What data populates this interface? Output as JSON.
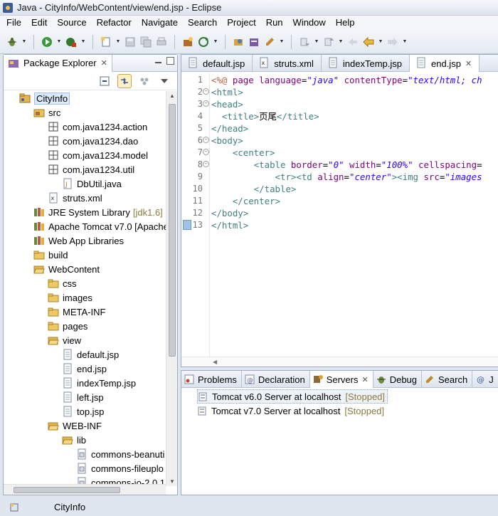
{
  "window": {
    "title": "Java - CityInfo/WebContent/view/end.jsp - Eclipse"
  },
  "menu": [
    "File",
    "Edit",
    "Source",
    "Refactor",
    "Navigate",
    "Search",
    "Project",
    "Run",
    "Window",
    "Help"
  ],
  "package_explorer": {
    "title": "Package Explorer",
    "tree": [
      {
        "label": "CityInfo",
        "indent": 0,
        "icon": "project-icon",
        "selected": true
      },
      {
        "label": "src",
        "indent": 1,
        "icon": "source-folder-icon"
      },
      {
        "label": "com.java1234.action",
        "indent": 2,
        "icon": "package-icon"
      },
      {
        "label": "com.java1234.dao",
        "indent": 2,
        "icon": "package-icon"
      },
      {
        "label": "com.java1234.model",
        "indent": 2,
        "icon": "package-icon"
      },
      {
        "label": "com.java1234.util",
        "indent": 2,
        "icon": "package-icon"
      },
      {
        "label": "DbUtil.java",
        "indent": 3,
        "icon": "java-file-icon"
      },
      {
        "label": "struts.xml",
        "indent": 2,
        "icon": "xml-file-icon"
      },
      {
        "label": "JRE System Library",
        "deco": "[jdk1.6]",
        "indent": 1,
        "icon": "library-icon"
      },
      {
        "label": "Apache Tomcat v7.0 [Apache",
        "indent": 1,
        "icon": "library-icon"
      },
      {
        "label": "Web App Libraries",
        "indent": 1,
        "icon": "library-icon"
      },
      {
        "label": "build",
        "indent": 1,
        "icon": "folder-icon"
      },
      {
        "label": "WebContent",
        "indent": 1,
        "icon": "folder-open-icon"
      },
      {
        "label": "css",
        "indent": 2,
        "icon": "folder-icon"
      },
      {
        "label": "images",
        "indent": 2,
        "icon": "folder-icon"
      },
      {
        "label": "META-INF",
        "indent": 2,
        "icon": "folder-icon"
      },
      {
        "label": "pages",
        "indent": 2,
        "icon": "folder-icon"
      },
      {
        "label": "view",
        "indent": 2,
        "icon": "folder-open-icon"
      },
      {
        "label": "default.jsp",
        "indent": 3,
        "icon": "jsp-file-icon"
      },
      {
        "label": "end.jsp",
        "indent": 3,
        "icon": "jsp-file-icon"
      },
      {
        "label": "indexTemp.jsp",
        "indent": 3,
        "icon": "jsp-file-icon"
      },
      {
        "label": "left.jsp",
        "indent": 3,
        "icon": "jsp-file-icon"
      },
      {
        "label": "top.jsp",
        "indent": 3,
        "icon": "jsp-file-icon"
      },
      {
        "label": "WEB-INF",
        "indent": 2,
        "icon": "folder-open-icon"
      },
      {
        "label": "lib",
        "indent": 3,
        "icon": "folder-open-icon"
      },
      {
        "label": "commons-beanuti",
        "indent": 4,
        "icon": "jar-file-icon"
      },
      {
        "label": "commons-fileuplo",
        "indent": 4,
        "icon": "jar-file-icon"
      },
      {
        "label": "commons-io-2.0.1",
        "indent": 4,
        "icon": "jar-file-icon"
      }
    ]
  },
  "editor": {
    "tabs": [
      {
        "label": "default.jsp",
        "active": false
      },
      {
        "label": "struts.xml",
        "active": false
      },
      {
        "label": "indexTemp.jsp",
        "active": false
      },
      {
        "label": "end.jsp",
        "active": true
      }
    ],
    "lines": [
      {
        "n": "1",
        "fold": false,
        "html": "<span class=\"jsp\">&lt;%@</span> <span class=\"attr\">page</span> <span class=\"attr\">language</span>=<span class=\"str\">\"java\"</span> <span class=\"attr\">contentType</span>=<span class=\"str\">\"text/html; ch</span>"
      },
      {
        "n": "2",
        "fold": true,
        "html": "<span class=\"tag\">&lt;html&gt;</span>"
      },
      {
        "n": "3",
        "fold": true,
        "html": "<span class=\"tag\">&lt;head&gt;</span>"
      },
      {
        "n": "4",
        "fold": false,
        "html": "  <span class=\"tag\">&lt;title&gt;</span>页尾<span class=\"tag\">&lt;/title&gt;</span>"
      },
      {
        "n": "5",
        "fold": false,
        "html": "<span class=\"tag\">&lt;/head&gt;</span>"
      },
      {
        "n": "6",
        "fold": true,
        "html": "<span class=\"tag\">&lt;body&gt;</span>"
      },
      {
        "n": "7",
        "fold": true,
        "html": "    <span class=\"tag\">&lt;center&gt;</span>"
      },
      {
        "n": "8",
        "fold": true,
        "html": "        <span class=\"tag\">&lt;table</span> <span class=\"attr\">border</span>=<span class=\"str\">\"0\"</span> <span class=\"attr\">width</span>=<span class=\"str\">\"100%\"</span> <span class=\"attr\">cellspacing</span>="
      },
      {
        "n": "9",
        "fold": false,
        "html": "            <span class=\"tag\">&lt;tr&gt;&lt;td</span> <span class=\"attr\">align</span>=<span class=\"str\">\"center\"</span><span class=\"tag\">&gt;&lt;img</span> <span class=\"attr\">src</span>=<span class=\"str\">\"images</span>"
      },
      {
        "n": "10",
        "fold": false,
        "html": "        <span class=\"tag\">&lt;/table&gt;</span>"
      },
      {
        "n": "11",
        "fold": false,
        "html": "    <span class=\"tag\">&lt;/center&gt;</span>"
      },
      {
        "n": "12",
        "fold": false,
        "html": "<span class=\"tag\">&lt;/body&gt;</span>"
      },
      {
        "n": "13",
        "fold": false,
        "html": "<span class=\"tag\">&lt;/html&gt;</span>"
      }
    ]
  },
  "bottom_panel": {
    "tabs": [
      {
        "label": "Problems",
        "icon": "problems-icon"
      },
      {
        "label": "Declaration",
        "icon": "declaration-icon"
      },
      {
        "label": "Servers",
        "icon": "servers-icon",
        "active": true
      },
      {
        "label": "Debug",
        "icon": "debug-icon"
      },
      {
        "label": "Search",
        "icon": "search-icon"
      },
      {
        "label": "J",
        "icon": "javadoc-icon"
      }
    ],
    "servers": [
      {
        "name": "Tomcat v6.0 Server at localhost",
        "status": "[Stopped]",
        "selected": true
      },
      {
        "name": "Tomcat v7.0 Server at localhost",
        "status": "[Stopped]"
      }
    ]
  },
  "status_bar": {
    "text": "CityInfo"
  }
}
